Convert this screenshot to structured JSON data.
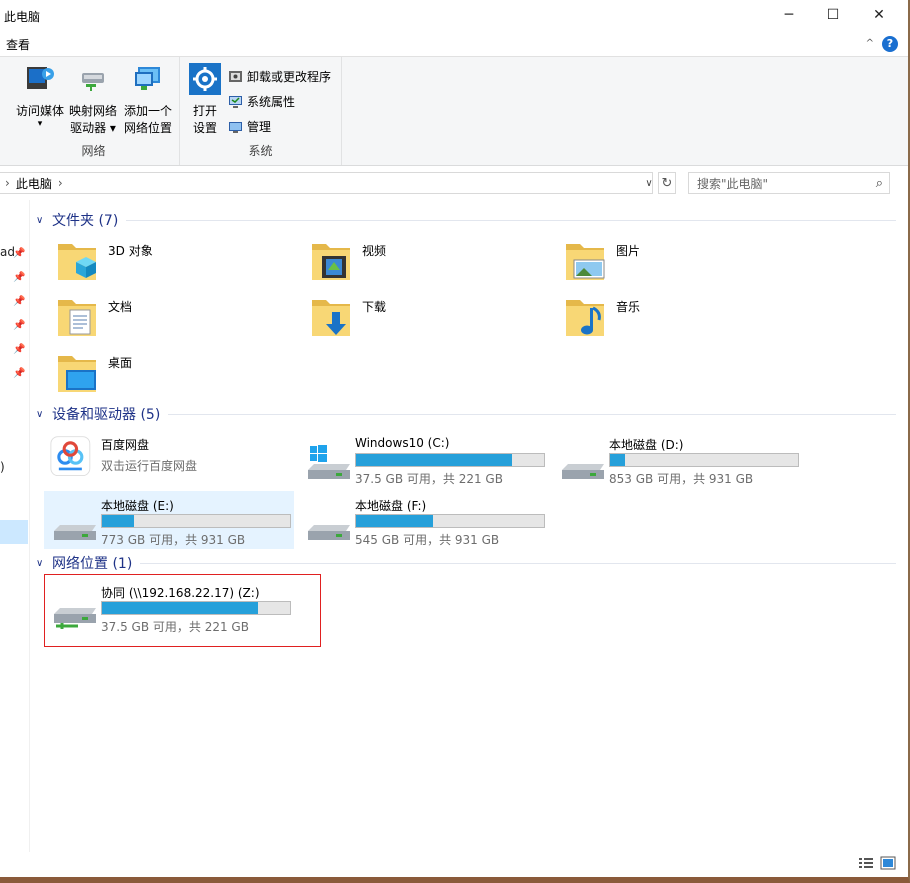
{
  "window": {
    "title": "此电脑",
    "minimize": "─",
    "maximize": "☐",
    "close": "✕"
  },
  "menu": {
    "view": "查看",
    "collapse": "^",
    "help": "?"
  },
  "ribbon": {
    "network_group": "网络",
    "system_group": "系统",
    "access_media": [
      "访问媒体",
      "▾"
    ],
    "map_drive": [
      "映射网络",
      "驱动器 ▾"
    ],
    "add_location": [
      "添加一个",
      "网络位置"
    ],
    "open_settings": [
      "打开",
      "设置"
    ],
    "uninstall": "卸载或更改程序",
    "system_props": "系统属性",
    "manage": "管理"
  },
  "address": {
    "sep1": "›",
    "crumb": "此电脑",
    "sep2": "›",
    "dropdown": "∨",
    "refresh": "↻",
    "search_placeholder": "搜索\"此电脑\"",
    "search_icon": "⌕"
  },
  "nav": {
    "frag1": "ad",
    "frag2": ")",
    "pin": "📌"
  },
  "sections": {
    "folders": "文件夹 (7)",
    "drives": "设备和驱动器 (5)",
    "network": "网络位置 (1)",
    "chevron": "∨"
  },
  "folders": [
    {
      "name": "3D 对象",
      "icon": "3d-objects-folder-icon"
    },
    {
      "name": "视频",
      "icon": "videos-folder-icon"
    },
    {
      "name": "图片",
      "icon": "pictures-folder-icon"
    },
    {
      "name": "文档",
      "icon": "documents-folder-icon"
    },
    {
      "name": "下载",
      "icon": "downloads-folder-icon"
    },
    {
      "name": "音乐",
      "icon": "music-folder-icon"
    },
    {
      "name": "桌面",
      "icon": "desktop-folder-icon"
    }
  ],
  "drives": [
    {
      "name": "百度网盘",
      "subtitle": "双击运行百度网盘"
    },
    {
      "name": "Windows10 (C:)",
      "info": "37.5 GB 可用，共 221 GB",
      "used_fraction": 0.83
    },
    {
      "name": "本地磁盘 (D:)",
      "info": "853 GB 可用，共 931 GB",
      "used_fraction": 0.08
    },
    {
      "name": "本地磁盘 (E:)",
      "info": "773 GB 可用，共 931 GB",
      "used_fraction": 0.17
    },
    {
      "name": "本地磁盘 (F:)",
      "info": "545 GB 可用，共 931 GB",
      "used_fraction": 0.41
    }
  ],
  "network_locations": [
    {
      "name": "协同 (\\\\192.168.22.17) (Z:)",
      "info": "37.5 GB 可用，共 221 GB",
      "used_fraction": 0.83
    }
  ],
  "colors": {
    "accent": "#1e3287",
    "bar_fill": "#26a0da",
    "selection": "#cce8ff",
    "highlight": "#e02020"
  }
}
